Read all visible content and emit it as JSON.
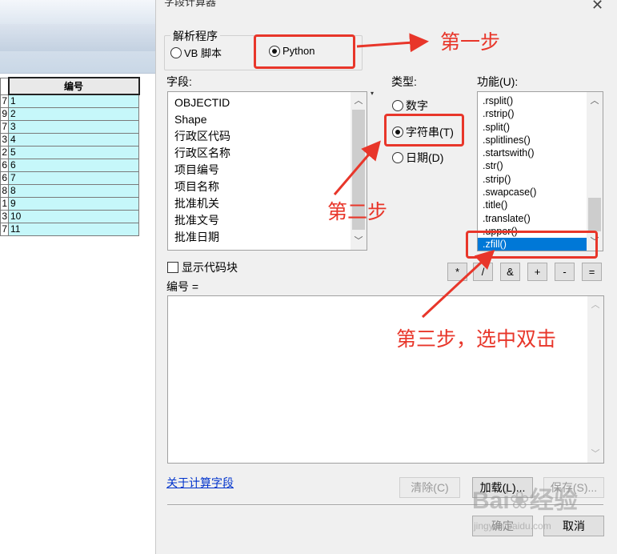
{
  "dialog": {
    "title": "字段计算器",
    "close_glyph": "✕"
  },
  "table": {
    "header": "编号",
    "rows": [
      {
        "left": "7",
        "value": "1"
      },
      {
        "left": "9",
        "value": "2"
      },
      {
        "left": "7",
        "value": "3"
      },
      {
        "left": "3",
        "value": "4"
      },
      {
        "left": "2",
        "value": "5"
      },
      {
        "left": "6",
        "value": "6"
      },
      {
        "left": "6",
        "value": "7"
      },
      {
        "left": "8",
        "value": "8"
      },
      {
        "left": "1",
        "value": "9"
      },
      {
        "left": "3",
        "value": "10"
      },
      {
        "left": "7",
        "value": "11"
      }
    ],
    "cell_color": "#c6f7fa"
  },
  "parser": {
    "legend": "解析程序",
    "vb_label": "VB 脚本",
    "python_label": "Python",
    "selected": "Python"
  },
  "fields": {
    "label": "字段:",
    "items": [
      "OBJECTID",
      "Shape",
      "行政区代码",
      "行政区名称",
      "项目编号",
      "项目名称",
      "批准机关",
      "批准文号",
      "批准日期"
    ]
  },
  "type": {
    "label": "类型:",
    "number_label": "数字",
    "string_label": "字符串(T)",
    "date_label": "日期(D)",
    "selected": "字符串(T)"
  },
  "functions": {
    "label": "功能(U):",
    "items": [
      ".rsplit()",
      ".rstrip()",
      ".split()",
      ".splitlines()",
      ".startswith()",
      ".str()",
      ".strip()",
      ".swapcase()",
      ".title()",
      ".translate()",
      ".upper()",
      ".zfill()"
    ],
    "selected": ".zfill()"
  },
  "operators": [
    "*",
    "/",
    "&",
    "+",
    "-",
    "="
  ],
  "show_codeblock_label": "显示代码块",
  "expression_label": "编号 =",
  "expression_value": "",
  "about_link": "关于计算字段",
  "buttons": {
    "clear": "清除(C)",
    "load": "加载(L)...",
    "save": "保存(S)...",
    "ok": "确定",
    "cancel": "取消"
  },
  "annotations": {
    "step1": "第一步",
    "step2": "第二步",
    "step3": "第三步，选中双击",
    "color": "#e8362a"
  },
  "watermark": {
    "brand": "Bai❀经验",
    "url": "jingyan.baidu.com"
  },
  "icons": [
    "close-icon",
    "scroll-up-icon",
    "scroll-down-icon",
    "arrow-icon"
  ]
}
